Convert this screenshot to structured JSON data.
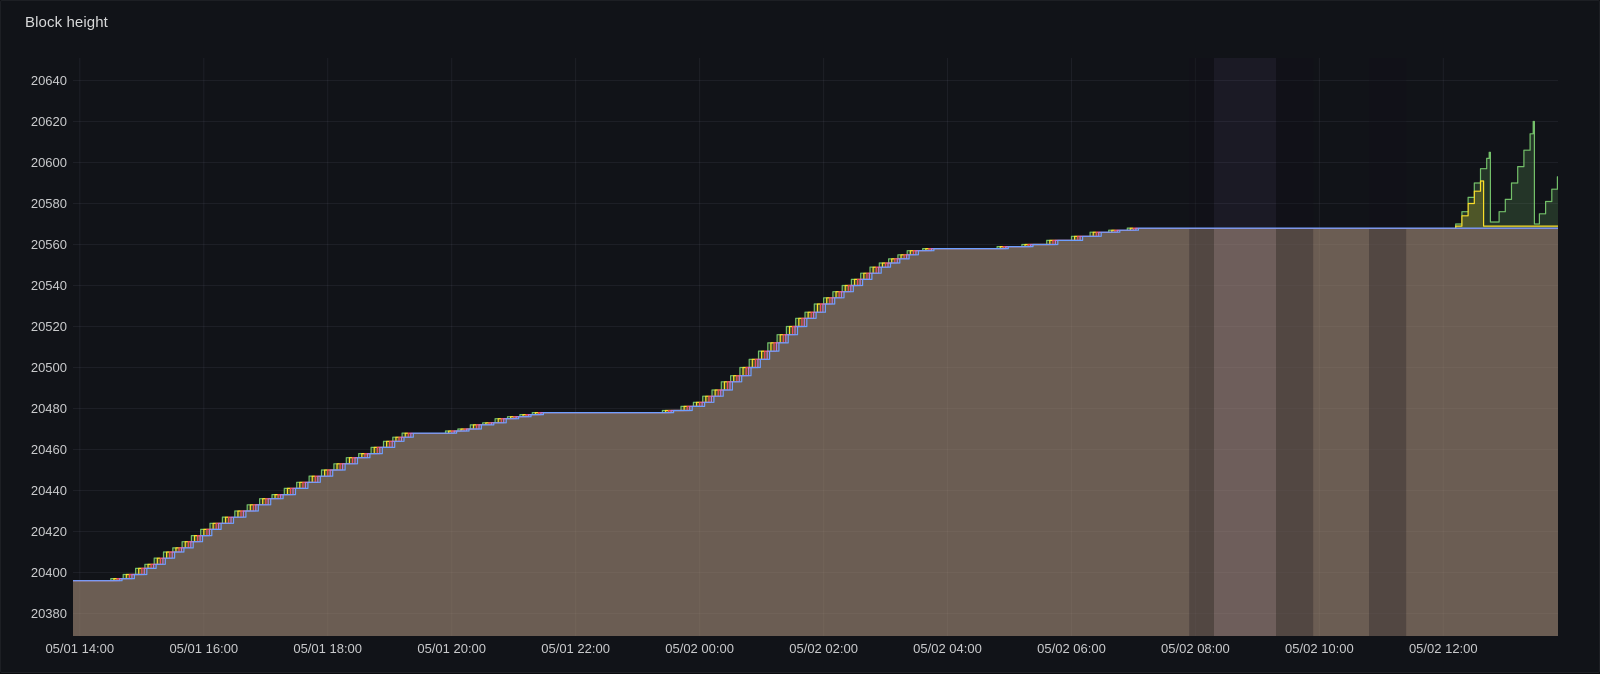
{
  "panel": {
    "title": "Block height"
  },
  "colors": {
    "background": "#111318",
    "border": "#1d1f24",
    "title_text": "#d8d9da",
    "axis_text": "#c9cacc",
    "grid": "rgba(204,204,220,0.07)"
  },
  "chart_data": {
    "type": "area",
    "title": "Block height",
    "xlabel": "",
    "ylabel": "",
    "grid": true,
    "legend": "none",
    "xlim": [
      -0.11,
      23.85
    ],
    "ylim": [
      20369,
      20651
    ],
    "x_unit": "hours since 05/01 14:00",
    "x_ticks": [
      {
        "t": 0,
        "label": "05/01 14:00"
      },
      {
        "t": 2,
        "label": "05/01 16:00"
      },
      {
        "t": 4,
        "label": "05/01 18:00"
      },
      {
        "t": 6,
        "label": "05/01 20:00"
      },
      {
        "t": 8,
        "label": "05/01 22:00"
      },
      {
        "t": 10,
        "label": "05/02 00:00"
      },
      {
        "t": 12,
        "label": "05/02 02:00"
      },
      {
        "t": 14,
        "label": "05/02 04:00"
      },
      {
        "t": 16,
        "label": "05/02 06:00"
      },
      {
        "t": 18,
        "label": "05/02 08:00"
      },
      {
        "t": 20,
        "label": "05/02 10:00"
      },
      {
        "t": 22,
        "label": "05/02 12:00"
      }
    ],
    "y_ticks": [
      20380,
      20400,
      20420,
      20440,
      20460,
      20480,
      20500,
      20520,
      20540,
      20560,
      20580,
      20600,
      20620,
      20640
    ],
    "base_points": [
      [
        0,
        20396
      ],
      [
        0.5,
        20397
      ],
      [
        0.7,
        20399
      ],
      [
        0.9,
        20402
      ],
      [
        1.05,
        20404
      ],
      [
        1.2,
        20407
      ],
      [
        1.35,
        20410
      ],
      [
        1.5,
        20412
      ],
      [
        1.65,
        20415
      ],
      [
        1.8,
        20418
      ],
      [
        1.95,
        20421
      ],
      [
        2.1,
        20424
      ],
      [
        2.3,
        20427
      ],
      [
        2.5,
        20430
      ],
      [
        2.7,
        20433
      ],
      [
        2.9,
        20436
      ],
      [
        3.1,
        20438
      ],
      [
        3.3,
        20441
      ],
      [
        3.5,
        20444
      ],
      [
        3.7,
        20447
      ],
      [
        3.9,
        20450
      ],
      [
        4.1,
        20453
      ],
      [
        4.3,
        20456
      ],
      [
        4.5,
        20458
      ],
      [
        4.7,
        20461
      ],
      [
        4.9,
        20464
      ],
      [
        5.05,
        20466
      ],
      [
        5.2,
        20468
      ],
      [
        5.9,
        20469
      ],
      [
        6.1,
        20470
      ],
      [
        6.3,
        20472
      ],
      [
        6.5,
        20473
      ],
      [
        6.7,
        20475
      ],
      [
        6.9,
        20476
      ],
      [
        7.1,
        20477
      ],
      [
        7.3,
        20478
      ],
      [
        9.4,
        20479
      ],
      [
        9.7,
        20481
      ],
      [
        9.9,
        20483
      ],
      [
        10.05,
        20486
      ],
      [
        10.2,
        20489
      ],
      [
        10.35,
        20493
      ],
      [
        10.5,
        20496
      ],
      [
        10.65,
        20500
      ],
      [
        10.8,
        20504
      ],
      [
        10.95,
        20508
      ],
      [
        11.1,
        20512
      ],
      [
        11.25,
        20516
      ],
      [
        11.4,
        20520
      ],
      [
        11.55,
        20524
      ],
      [
        11.7,
        20527
      ],
      [
        11.85,
        20531
      ],
      [
        12,
        20534
      ],
      [
        12.15,
        20537
      ],
      [
        12.3,
        20540
      ],
      [
        12.45,
        20543
      ],
      [
        12.6,
        20546
      ],
      [
        12.75,
        20549
      ],
      [
        12.9,
        20551
      ],
      [
        13.05,
        20553
      ],
      [
        13.2,
        20555
      ],
      [
        13.35,
        20557
      ],
      [
        13.6,
        20558
      ],
      [
        14.8,
        20559
      ],
      [
        15.2,
        20560
      ],
      [
        15.6,
        20562
      ],
      [
        16,
        20564
      ],
      [
        16.3,
        20566
      ],
      [
        16.6,
        20567
      ],
      [
        16.9,
        20568
      ],
      [
        22.1,
        20568
      ]
    ],
    "series": [
      {
        "name": "series-green",
        "color": "#73BF69",
        "fill_opacity": 0.2,
        "t_offset": 0,
        "use_base": true,
        "extra": [
          [
            22.2,
            20570
          ],
          [
            22.3,
            20576
          ],
          [
            22.4,
            20583
          ],
          [
            22.5,
            20590
          ],
          [
            22.6,
            20597
          ],
          [
            22.7,
            20602
          ],
          [
            22.74,
            20605
          ],
          [
            22.76,
            20571
          ],
          [
            22.9,
            20576
          ],
          [
            23,
            20582
          ],
          [
            23.1,
            20590
          ],
          [
            23.2,
            20598
          ],
          [
            23.3,
            20606
          ],
          [
            23.4,
            20614
          ],
          [
            23.45,
            20620
          ],
          [
            23.47,
            20570
          ],
          [
            23.55,
            20575
          ],
          [
            23.65,
            20581
          ],
          [
            23.75,
            20587
          ],
          [
            23.84,
            20593
          ]
        ]
      },
      {
        "name": "series-yellow",
        "color": "#FADE2A",
        "fill_opacity": 0.2,
        "t_offset": 0.05,
        "use_base": true,
        "extra": [
          [
            22.2,
            20569
          ],
          [
            22.3,
            20574
          ],
          [
            22.4,
            20580
          ],
          [
            22.5,
            20586
          ],
          [
            22.6,
            20591
          ],
          [
            22.65,
            20569
          ],
          [
            23.84,
            20569
          ]
        ]
      },
      {
        "name": "series-red",
        "color": "#F2495C",
        "fill_opacity": 0.12,
        "t_offset": 0.1,
        "use_base": true,
        "extra": [
          [
            23.84,
            20568
          ]
        ]
      },
      {
        "name": "series-purple",
        "color": "#B877D9",
        "fill_opacity": 0.12,
        "t_offset": 0.14,
        "use_base": true,
        "extra": [
          [
            23.84,
            20568
          ]
        ]
      },
      {
        "name": "series-blue",
        "color": "#6E9FFF",
        "fill_opacity": 0.09,
        "t_offset": 0.18,
        "use_base": true,
        "extra": [
          [
            23.84,
            20568
          ]
        ]
      }
    ],
    "regions": [
      {
        "from": "05/02 07:54",
        "to": "05/02 08:18",
        "t_from": 17.9,
        "t_to": 18.3,
        "color": "rgba(18,16,26,0.28)"
      },
      {
        "from": "05/02 08:18",
        "to": "05/02 09:18",
        "t_from": 18.3,
        "t_to": 19.3,
        "color": "rgba(150,110,185,0.08)"
      },
      {
        "from": "05/02 09:18",
        "to": "05/02 09:54",
        "t_from": 19.3,
        "t_to": 19.9,
        "color": "rgba(18,16,26,0.28)"
      },
      {
        "from": "05/02 10:48",
        "to": "05/02 11:24",
        "t_from": 20.8,
        "t_to": 21.4,
        "color": "rgba(18,16,26,0.28)"
      }
    ]
  }
}
